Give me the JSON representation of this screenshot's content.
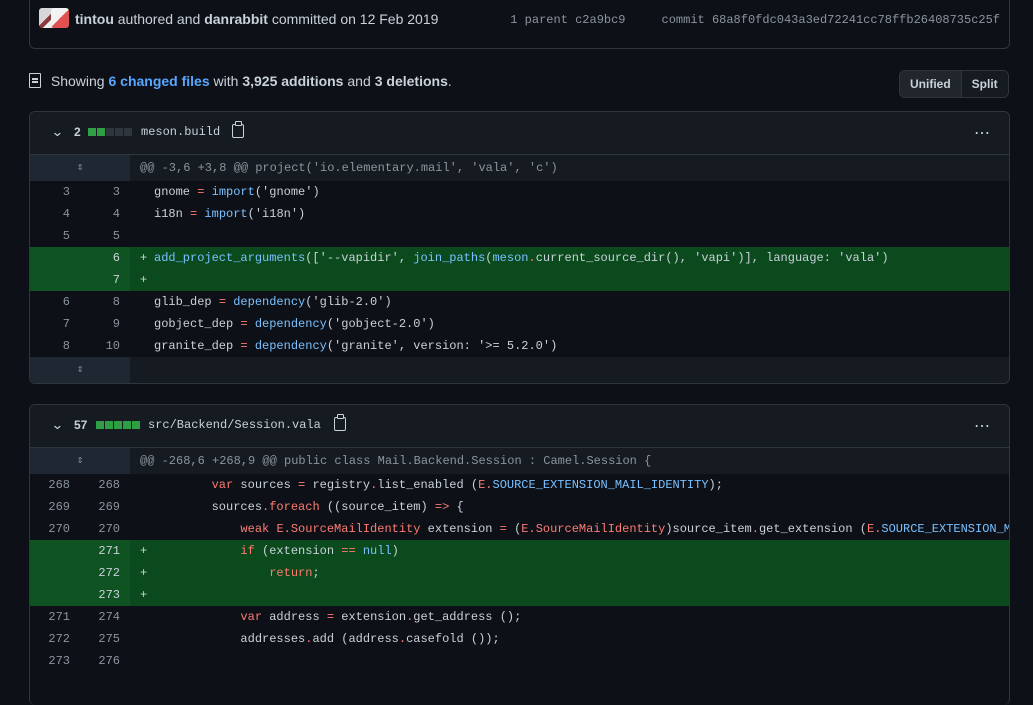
{
  "commit": {
    "author": "tintou",
    "authored_text": "authored and",
    "committer": "danrabbit",
    "committed_text": "committed on 12 Feb 2019",
    "parent_label": "1 parent",
    "parent_hash": "c2a9bc9",
    "commit_label": "commit",
    "commit_hash": "68a8f0fdc043a3ed72241cc78ffb26408735c25f"
  },
  "summary": {
    "prefix": "Showing",
    "changed_files": "6 changed files",
    "with": "with",
    "additions": "3,925 additions",
    "and": "and",
    "deletions": "3 deletions",
    "suffix": "."
  },
  "view_toggle": {
    "unified": "Unified",
    "split": "Split",
    "active": "unified"
  },
  "files": [
    {
      "count": "2",
      "bars": [
        "add",
        "add",
        "neu",
        "neu",
        "neu"
      ],
      "name": "meson.build",
      "hunk": "@@ -3,6 +3,8 @@ project('io.elementary.mail', 'vala', 'c')"
    },
    {
      "count": "57",
      "bars": [
        "add",
        "add",
        "add",
        "add",
        "add"
      ],
      "name": "src/Backend/Session.vala",
      "hunk": "@@ -268,6 +268,9 @@ public class Mail.Backend.Session : Camel.Session {"
    }
  ],
  "file1_lines": [
    {
      "old": "3",
      "new": "3",
      "type": "ctx"
    },
    {
      "old": "4",
      "new": "4",
      "type": "ctx"
    },
    {
      "old": "5",
      "new": "5",
      "type": "ctx"
    },
    {
      "old": "",
      "new": "6",
      "type": "add"
    },
    {
      "old": "",
      "new": "7",
      "type": "add"
    },
    {
      "old": "6",
      "new": "8",
      "type": "ctx"
    },
    {
      "old": "7",
      "new": "9",
      "type": "ctx"
    },
    {
      "old": "8",
      "new": "10",
      "type": "ctx"
    }
  ],
  "file2_lines": [
    {
      "old": "268",
      "new": "268",
      "type": "ctx"
    },
    {
      "old": "269",
      "new": "269",
      "type": "ctx"
    },
    {
      "old": "270",
      "new": "270",
      "type": "ctx"
    },
    {
      "old": "",
      "new": "271",
      "type": "add"
    },
    {
      "old": "",
      "new": "272",
      "type": "add"
    },
    {
      "old": "",
      "new": "273",
      "type": "add"
    },
    {
      "old": "271",
      "new": "274",
      "type": "ctx"
    },
    {
      "old": "272",
      "new": "275",
      "type": "ctx"
    },
    {
      "old": "273",
      "new": "276",
      "type": "ctx"
    }
  ],
  "code": {
    "f1_l1_a": "gnome",
    "f1_l1_b": "import",
    "f1_l1_c": "('gnome')",
    "f1_l2_a": "i18n",
    "f1_l2_b": "import",
    "f1_l2_c": "('i18n')",
    "f1_l4_a": "add_project_arguments",
    "f1_l4_b": "(['--vapidir', ",
    "f1_l4_c": "join_paths",
    "f1_l4_d": "meson",
    "f1_l4_e": "current_source_dir(), 'vapi')], language: 'vala')",
    "f1_l6_a": "glib_dep",
    "f1_l6_b": "dependency",
    "f1_l6_c": "('glib-2.0')",
    "f1_l7_a": "gobject_dep",
    "f1_l7_b": "dependency",
    "f1_l7_c": "('gobject-2.0')",
    "f1_l8_a": "granite_dep",
    "f1_l8_b": "dependency",
    "f1_l8_c": "('granite', version: '>= 5.2.0')",
    "f2_l1_a": "var",
    "f2_l1_b": "sources",
    "f2_l1_c": "registry",
    "f2_l1_d": "list_enabled (",
    "f2_l1_e": "E",
    "f2_l1_f": "SOURCE_EXTENSION_MAIL_IDENTITY",
    "f2_l1_g": ");",
    "f2_l2_a": "sources",
    "f2_l2_b": "foreach",
    "f2_l2_c": " ((source_item) ",
    "f2_l2_d": "=>",
    "f2_l2_e": " {",
    "f2_l3_a": "weak",
    "f2_l3_b": "E",
    "f2_l3_c": "SourceMailIdentity",
    "f2_l3_d": "extension",
    "f2_l3_e": "E",
    "f2_l3_f": "SourceMailIdentity",
    "f2_l3_g": ")source_item",
    "f2_l3_h": "get_extension (",
    "f2_l3_i": "E",
    "f2_l3_j": "SOURCE_EXTENSION_M",
    "f2_l4_a": "if",
    "f2_l4_b": " (extension ",
    "f2_l4_c": "==",
    "f2_l4_d": "null",
    "f2_l4_e": ")",
    "f2_l5_a": "return",
    "f2_l5_b": ";",
    "f2_l7_a": "var",
    "f2_l7_b": "address",
    "f2_l7_c": "extension",
    "f2_l7_d": "get_address ();",
    "f2_l8_a": "addresses",
    "f2_l8_b": "add (address",
    "f2_l8_c": "casefold ());"
  },
  "icons": {
    "expand": "expand-icon",
    "collapse": "chevron-down-icon",
    "copy": "copy-icon",
    "more": "kebab-icon",
    "file": "file-diff-icon"
  },
  "colors": {
    "accent": "#58a6ff",
    "addition_bg": "#0b4a1d",
    "addition_gutter": "#0f5323",
    "bar_add": "#2ea043"
  }
}
